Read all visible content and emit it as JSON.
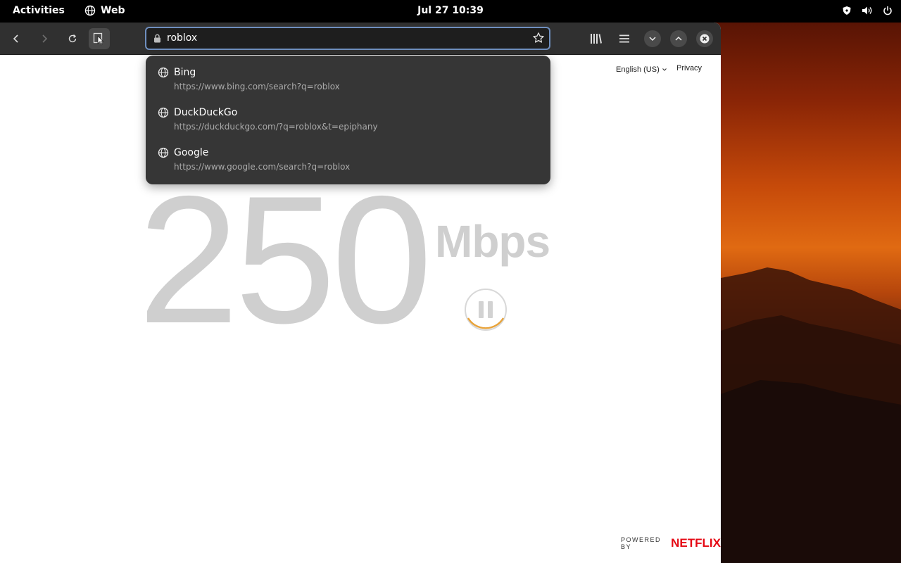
{
  "topbar": {
    "activities": "Activities",
    "app_name": "Web",
    "clock": "Jul 27  10:39"
  },
  "browser": {
    "url_text": "roblox",
    "suggestions": [
      {
        "name": "Bing",
        "url": "https://www.bing.com/search?q=roblox"
      },
      {
        "name": "DuckDuckGo",
        "url": "https://duckduckgo.com/?q=roblox&t=epiphany"
      },
      {
        "name": "Google",
        "url": "https://www.google.com/search?q=roblox"
      }
    ]
  },
  "page": {
    "language": "English (US)",
    "privacy": "Privacy",
    "speed_value": "250",
    "speed_units": "Mbps",
    "powered_by": "POWERED BY",
    "brand": "NETFLIX",
    "brand_color": "#e50914",
    "spinner_color": "#e8a33a"
  }
}
